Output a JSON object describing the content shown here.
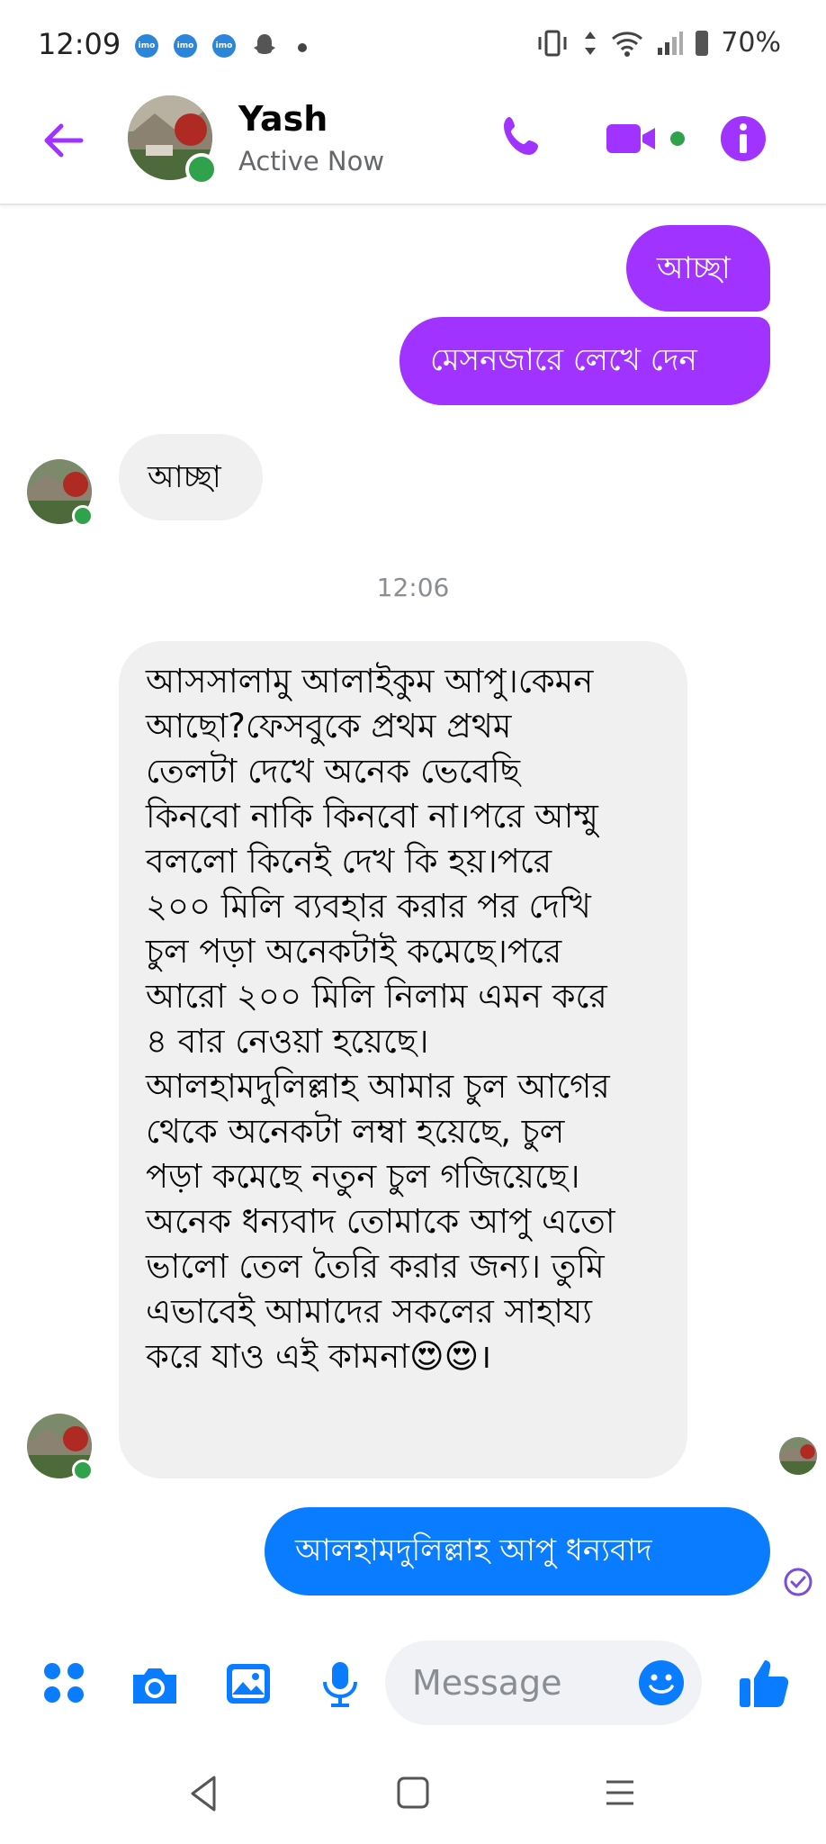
{
  "status_bar": {
    "time": "12:09",
    "battery": "70%",
    "notification_icons": [
      "imo-icon",
      "imo-icon",
      "imo-icon",
      "snapchat-icon"
    ]
  },
  "header": {
    "contact_name": "Yash",
    "contact_status": "Active Now",
    "accent_color": "#a033ff"
  },
  "messages": [
    {
      "side": "outgoing",
      "text": "আচ্ছা",
      "color": "#a033ff"
    },
    {
      "side": "outgoing",
      "text": "মেসনজারে লেখে দেন",
      "color": "#a033ff"
    },
    {
      "side": "incoming",
      "text": "আচ্ছা"
    },
    {
      "side": "incoming",
      "text": "আসসালামু আলাইকুম আপু।কেমন\nআছো?ফেসবুকে প্রথম প্রথম\nতেলটা দেখে অনেক ভেবেছি\nকিনবো নাকি কিনবো না।পরে আম্মু\nবললো কিনেই দেখ কি হয়।পরে\n২০০ মিলি ব্যবহার করার পর দেখি\nচুল পড়া অনেকটাই কমেছে।পরে\nআরো ২০০ মিলি নিলাম এমন করে\n৪ বার নেওয়া হয়েছে।\nআলহামদুলিল্লাহ আমার চুল আগের\nথেকে অনেকটা লম্বা হয়েছে, চুল\nপড়া কমেছে নতুন চুল গজিয়েছে।\nঅনেক ধন্যবাদ তোমাকে আপু এতো\nভালো তেল তৈরি করার জন্য। তুমি\nএভাবেই আমাদের সকলের সাহায্য\nকরে যাও এই কামনা😍😍।"
    },
    {
      "side": "outgoing",
      "text": "আলহামদুলিল্লাহ আপু ধন্যবাদ",
      "color": "#0a7cff"
    }
  ],
  "timestamp": "12:06",
  "composer": {
    "placeholder": "Message",
    "icons": [
      "apps-icon",
      "camera-icon",
      "gallery-icon",
      "microphone-icon",
      "emoji-icon",
      "thumbs-up-icon"
    ],
    "accent_color": "#0a7cff"
  },
  "nav_bar": {
    "icons": [
      "back-nav-icon",
      "home-nav-icon",
      "recents-nav-icon"
    ]
  }
}
